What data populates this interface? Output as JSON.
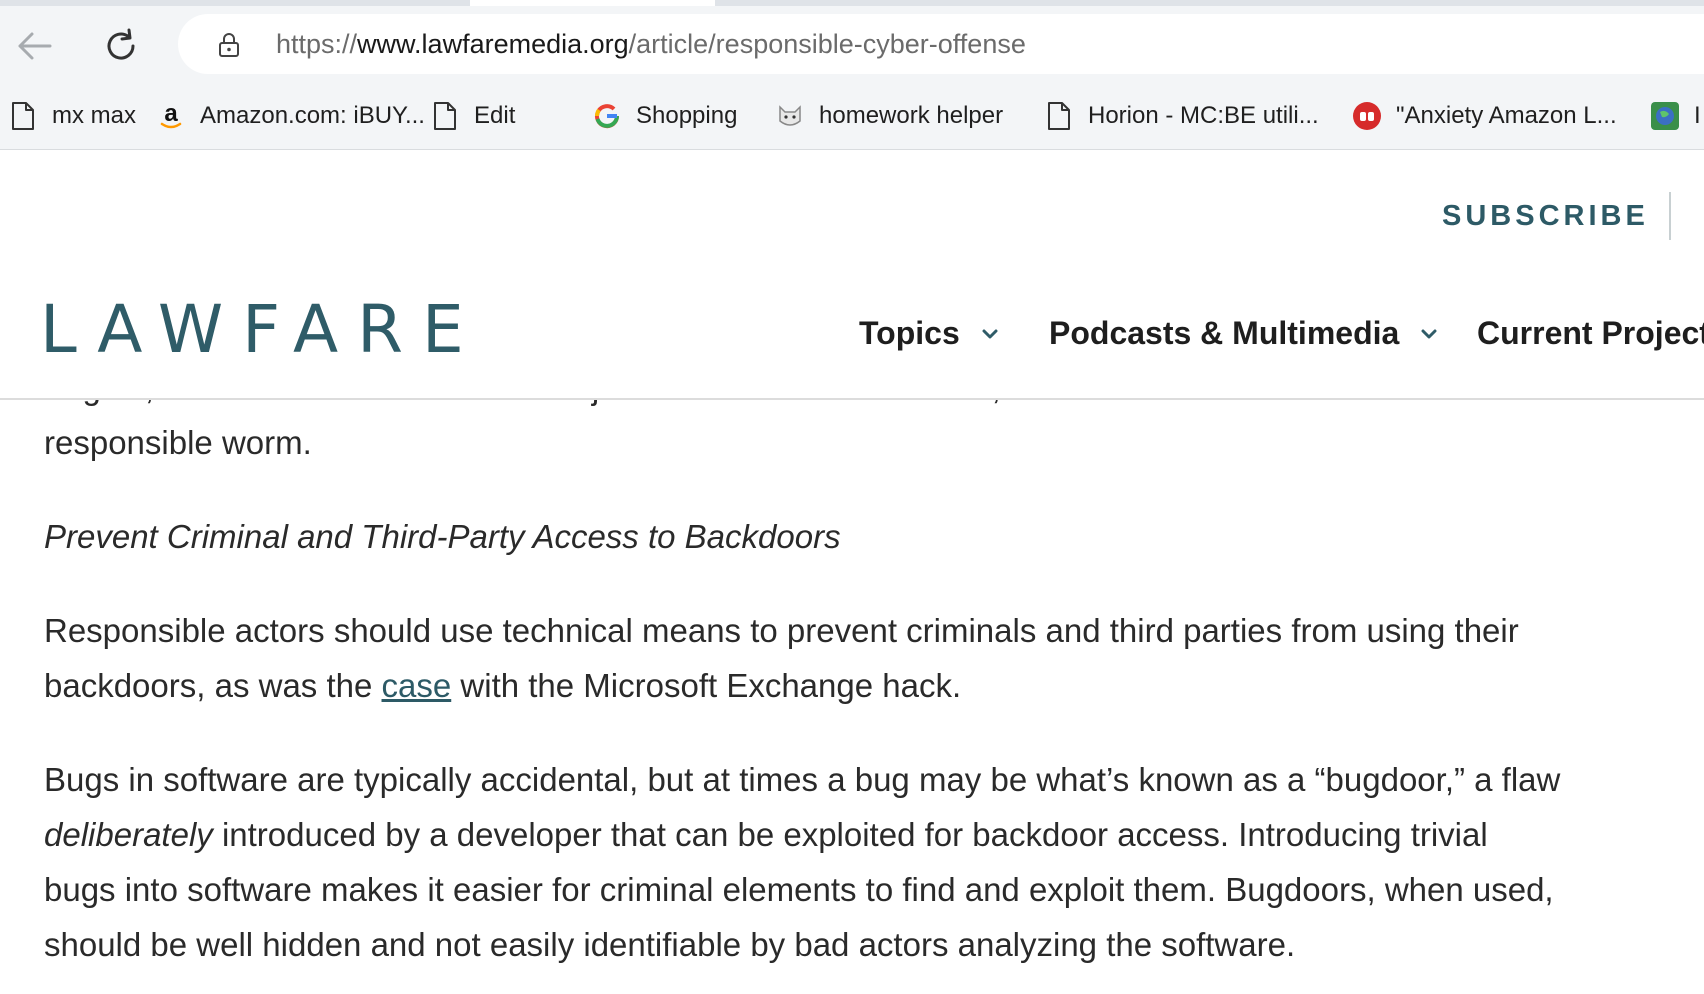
{
  "browser": {
    "url_scheme": "https://",
    "url_host": "www.lawfaremedia.org",
    "url_path": "/article/responsible-cyber-offense",
    "bookmarks": [
      {
        "label": "mx max",
        "icon": "document-icon"
      },
      {
        "label": "Amazon.com: iBUY...",
        "icon": "amazon-icon"
      },
      {
        "label": "Edit",
        "icon": "document-icon"
      },
      {
        "label": "Shopping",
        "icon": "google-icon"
      },
      {
        "label": "homework helper",
        "icon": "cat-icon"
      },
      {
        "label": "Horion - MC:BE utili...",
        "icon": "document-icon"
      },
      {
        "label": "\"Anxiety Amazon L...",
        "icon": "red-app-icon"
      },
      {
        "label": "I",
        "icon": "earth-icon"
      }
    ]
  },
  "site": {
    "subscribe_label": "SUBSCRIBE",
    "logo_text": "LAWFARE",
    "nav": {
      "topics": "Topics",
      "podcasts": "Podcasts & Multimedia",
      "projects": "Current Projects"
    },
    "brand_color": "#2f5c68"
  },
  "article": {
    "cutoff_line": "targets, and restrict effects to valid objectives. In almost all cases, a smarter worm is a safer and more",
    "cutoff_end": "responsible worm.",
    "subhead": "Prevent Criminal and Third-Party Access to Backdoors",
    "p1_before": "Responsible actors should use technical means to prevent criminals and third parties from using their backdoors, as was the ",
    "p1_link": "case",
    "p1_after": " with the Microsoft Exchange hack.",
    "p2_before": "Bugs in software are typically accidental, but at times a bug may be what’s known as a “bugdoor,” a flaw ",
    "p2_em": "deliberately",
    "p2_after": " introduced by a developer that can be exploited for backdoor access. Introducing trivial bugs into software makes it easier for criminal elements to find and exploit them. Bugdoors, when used, should be well hidden and not easily identifiable by bad actors analyzing the software."
  }
}
